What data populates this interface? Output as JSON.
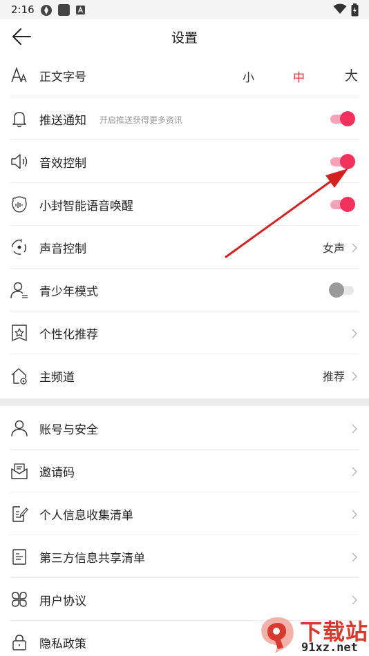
{
  "status_bar": {
    "time": "2:16"
  },
  "header": {
    "title": "设置"
  },
  "font_size": {
    "label": "正文字号",
    "options": [
      "小",
      "中",
      "大"
    ],
    "selected": "中"
  },
  "general": [
    {
      "label": "推送通知",
      "sub": "开启推送获得更多资讯",
      "toggle": true
    },
    {
      "label": "音效控制",
      "toggle": true
    },
    {
      "label": "小封智能语音唤醒",
      "toggle": true
    },
    {
      "label": "声音控制",
      "value": "女声"
    },
    {
      "label": "青少年模式",
      "toggle": false
    },
    {
      "label": "个性化推荐"
    },
    {
      "label": "主频道",
      "value": "推荐"
    }
  ],
  "account": [
    {
      "label": "账号与安全"
    },
    {
      "label": "邀请码"
    },
    {
      "label": "个人信息收集清单"
    },
    {
      "label": "第三方信息共享清单"
    },
    {
      "label": "用户协议"
    },
    {
      "label": "隐私政策"
    }
  ],
  "watermark": {
    "brand": "下载站",
    "domain": "91xz.net"
  },
  "colors": {
    "accent": "#f2325d",
    "track_on": "#f7a2b7",
    "selected_text": "#e8352f",
    "arrow": "#d42020"
  }
}
